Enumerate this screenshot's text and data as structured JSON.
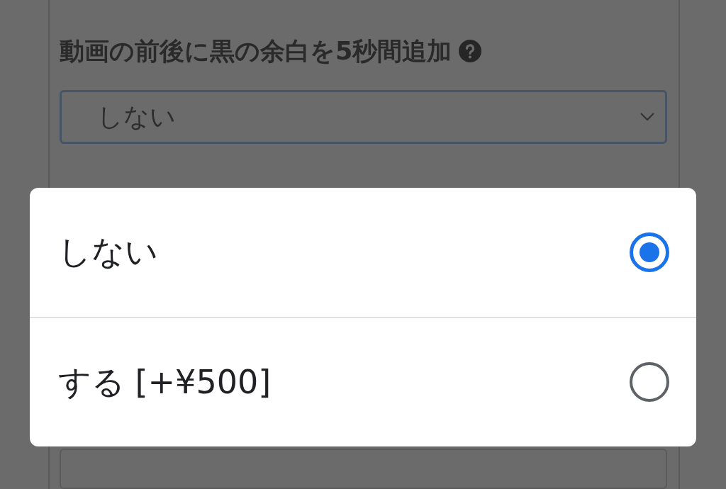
{
  "field": {
    "label": "動画の前後に黒の余白を5秒間追加",
    "value": "しない"
  },
  "dialog": {
    "options": [
      {
        "label": "しない",
        "selected": true
      },
      {
        "label": "する [+¥500]",
        "selected": false
      }
    ]
  }
}
